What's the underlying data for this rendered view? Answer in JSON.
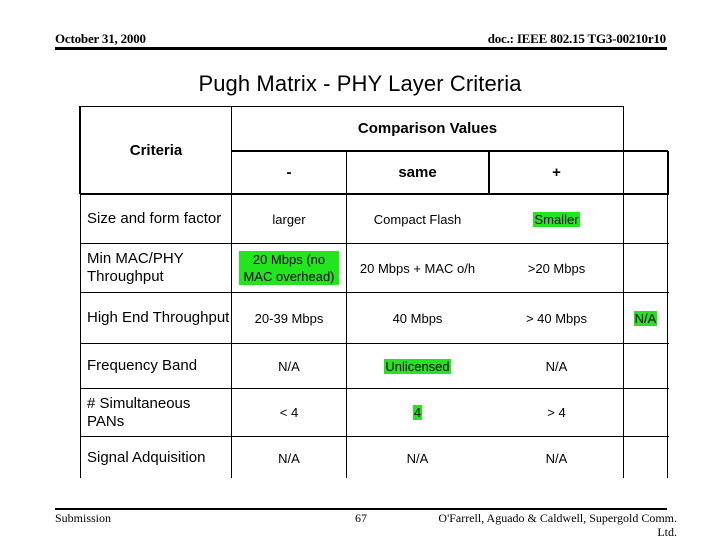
{
  "header": {
    "date": "October 31, 2000",
    "doc_id": "doc.: IEEE 802.15  TG3-00210r10"
  },
  "title": "Pugh Matrix - PHY Layer Criteria",
  "table": {
    "criteria_header": "Criteria",
    "comparison_header": "Comparison Values",
    "columns": [
      "-",
      "same",
      "+"
    ],
    "highlight_color": "#22e51f",
    "rows": [
      {
        "criteria": "Size and form factor",
        "minus": "larger",
        "same": "Compact Flash",
        "plus": "Smaller",
        "extra": "",
        "highlight": "plus"
      },
      {
        "criteria": "Min MAC/PHY Throughput",
        "minus": "20 Mbps (no MAC overhead)",
        "same": "20 Mbps + MAC o/h",
        "plus": ">20 Mbps",
        "extra": "",
        "highlight": "minus"
      },
      {
        "criteria": "High End Throughput",
        "minus": "20-39 Mbps",
        "same": "40 Mbps",
        "plus": "> 40 Mbps",
        "extra": "N/A",
        "highlight": "extra"
      },
      {
        "criteria": "Frequency Band",
        "minus": "N/A",
        "same": "Unlicensed",
        "plus": "N/A",
        "extra": "",
        "highlight": "same"
      },
      {
        "criteria": "# Simultaneous PANs",
        "minus": "< 4",
        "same": "4",
        "plus": "> 4",
        "extra": "",
        "highlight": "same"
      },
      {
        "criteria": "Signal Adquisition",
        "minus": "N/A",
        "same": "N/A",
        "plus": "N/A",
        "extra": "",
        "highlight": ""
      }
    ]
  },
  "footer": {
    "left": "Submission",
    "page": "67",
    "authors_line1": "O'Farrell, Aguado & Caldwell, Supergold Comm.",
    "authors_line2": "Ltd."
  }
}
